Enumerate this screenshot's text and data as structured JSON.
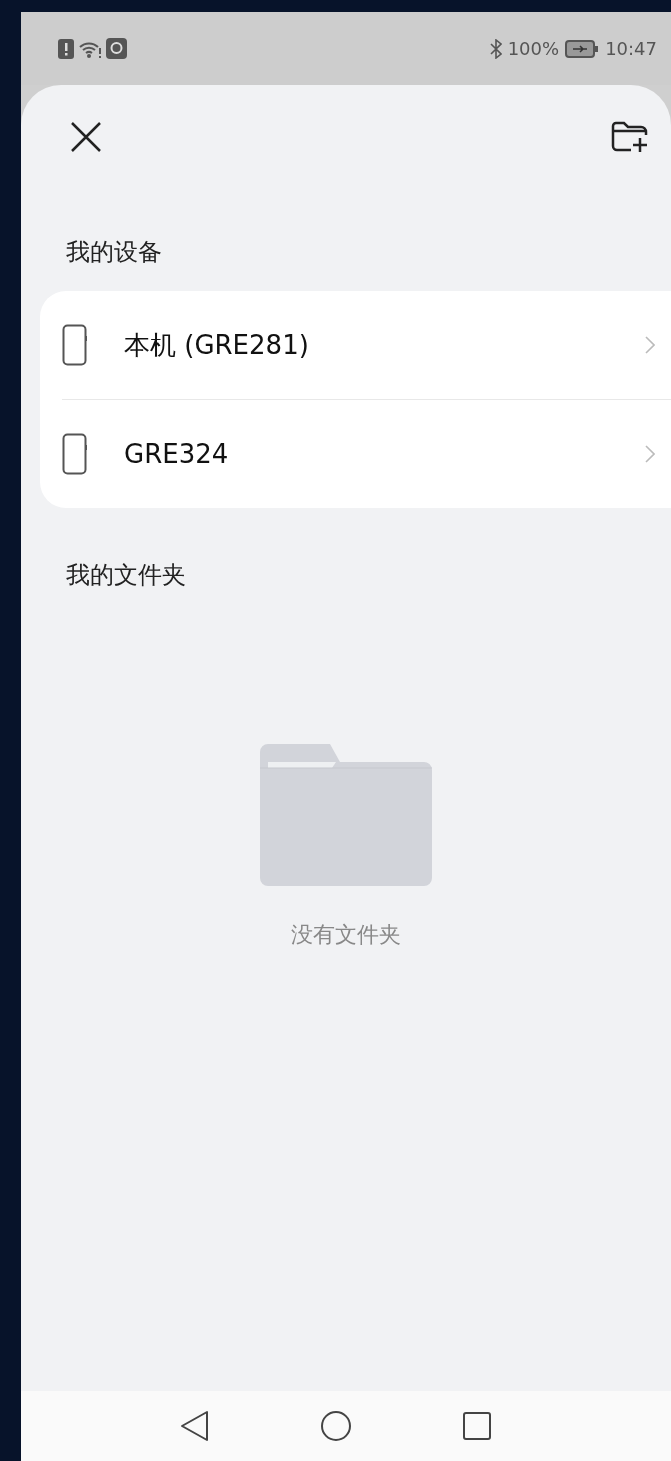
{
  "status_bar": {
    "battery": "100%",
    "time": "10:47"
  },
  "devices_title": "我的设备",
  "devices": [
    {
      "name": "本机 (GRE281)"
    },
    {
      "name": "GRE324"
    }
  ],
  "folders_title": "我的文件夹",
  "empty_message": "没有文件夹"
}
